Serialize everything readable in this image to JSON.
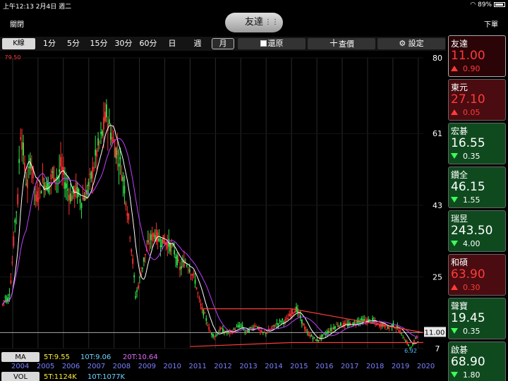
{
  "status": {
    "left": "上午12:13  2月4日 週二",
    "right": "89%"
  },
  "header": {
    "close_label": "關閉",
    "stock_name": "友達",
    "order_label": "下單"
  },
  "toolbar": {
    "kline": "K線",
    "periods": [
      "1分",
      "5分",
      "15分",
      "30分",
      "60分",
      "日",
      "週",
      "月"
    ],
    "restore_label": "還原",
    "lookup_label": "查價",
    "settings_label": "設定"
  },
  "chart_data": {
    "type": "candlestick",
    "symbol": "友達",
    "period": "月",
    "y_ticks": [
      80,
      61,
      43,
      25,
      7
    ],
    "ylim": [
      7,
      80
    ],
    "x_tick_labels": [
      "2004",
      "2005",
      "2006",
      "2007",
      "2008",
      "2009",
      "2010",
      "2011",
      "2012",
      "2013",
      "2014",
      "2015",
      "2016",
      "2017",
      "2018",
      "2019",
      "2020"
    ],
    "xlim": [
      2003.5,
      2020.2
    ],
    "high_label": "79.50",
    "low_label": "6.92",
    "current_price_label": "11.00",
    "current_price": 11.0,
    "price_path": [
      [
        2003.6,
        18
      ],
      [
        2003.7,
        20
      ],
      [
        2003.8,
        19
      ],
      [
        2003.9,
        22
      ],
      [
        2004.0,
        30
      ],
      [
        2004.1,
        40
      ],
      [
        2004.2,
        44
      ],
      [
        2004.3,
        62
      ],
      [
        2004.4,
        58
      ],
      [
        2004.5,
        50
      ],
      [
        2004.6,
        48
      ],
      [
        2004.7,
        55
      ],
      [
        2004.8,
        51
      ],
      [
        2004.9,
        44
      ],
      [
        2005.0,
        46
      ],
      [
        2005.2,
        49
      ],
      [
        2005.4,
        48
      ],
      [
        2005.6,
        51
      ],
      [
        2005.8,
        50
      ],
      [
        2005.9,
        53
      ],
      [
        2006.1,
        48
      ],
      [
        2006.3,
        45
      ],
      [
        2006.5,
        47
      ],
      [
        2006.7,
        44
      ],
      [
        2006.9,
        46
      ],
      [
        2007.1,
        50
      ],
      [
        2007.3,
        56
      ],
      [
        2007.5,
        60
      ],
      [
        2007.7,
        66
      ],
      [
        2007.8,
        63
      ],
      [
        2008.0,
        58
      ],
      [
        2008.2,
        55
      ],
      [
        2008.4,
        48
      ],
      [
        2008.6,
        38
      ],
      [
        2008.75,
        28
      ],
      [
        2008.85,
        20
      ],
      [
        2009.0,
        24
      ],
      [
        2009.2,
        30
      ],
      [
        2009.4,
        34
      ],
      [
        2009.6,
        36
      ],
      [
        2009.8,
        34
      ],
      [
        2010.0,
        34
      ],
      [
        2010.2,
        33
      ],
      [
        2010.4,
        31
      ],
      [
        2010.6,
        27
      ],
      [
        2010.8,
        29
      ],
      [
        2011.0,
        27
      ],
      [
        2011.2,
        24
      ],
      [
        2011.4,
        18
      ],
      [
        2011.6,
        15
      ],
      [
        2011.8,
        11
      ],
      [
        2012.0,
        10
      ],
      [
        2012.2,
        12
      ],
      [
        2012.4,
        11
      ],
      [
        2012.6,
        11
      ],
      [
        2012.8,
        12
      ],
      [
        2013.0,
        13
      ],
      [
        2013.2,
        11
      ],
      [
        2013.4,
        12
      ],
      [
        2013.6,
        13
      ],
      [
        2013.8,
        11
      ],
      [
        2014.0,
        11
      ],
      [
        2014.2,
        12
      ],
      [
        2014.4,
        13
      ],
      [
        2014.6,
        14
      ],
      [
        2014.8,
        14
      ],
      [
        2015.0,
        16
      ],
      [
        2015.2,
        17
      ],
      [
        2015.4,
        14
      ],
      [
        2015.6,
        11
      ],
      [
        2015.8,
        10
      ],
      [
        2016.0,
        9
      ],
      [
        2016.2,
        10
      ],
      [
        2016.4,
        11
      ],
      [
        2016.6,
        12
      ],
      [
        2016.8,
        13
      ],
      [
        2017.0,
        13
      ],
      [
        2017.2,
        13
      ],
      [
        2017.4,
        13
      ],
      [
        2017.6,
        14
      ],
      [
        2017.8,
        14
      ],
      [
        2018.0,
        14
      ],
      [
        2018.2,
        14
      ],
      [
        2018.4,
        13
      ],
      [
        2018.6,
        13
      ],
      [
        2018.8,
        12
      ],
      [
        2019.0,
        13
      ],
      [
        2019.2,
        12
      ],
      [
        2019.4,
        10
      ],
      [
        2019.6,
        8
      ],
      [
        2019.7,
        7
      ],
      [
        2019.8,
        8
      ],
      [
        2019.9,
        10
      ],
      [
        2020.0,
        11
      ]
    ],
    "upper_trendline": [
      [
        2011.5,
        17
      ],
      [
        2014.0,
        17
      ],
      [
        2015.0,
        17
      ],
      [
        2020.2,
        11
      ]
    ],
    "lower_trendline": [
      [
        2011.0,
        7.5
      ],
      [
        2015.0,
        8.5
      ],
      [
        2020.2,
        8.5
      ]
    ],
    "colors": {
      "up": "#ff3030",
      "down": "#2ee84a",
      "ma": "#ffffff",
      "ma2": "#c040ff",
      "trend": "#ff3a3a",
      "grid": "#2a2a2a",
      "label": "#ff3b3b"
    }
  },
  "ma": {
    "tag": "MA",
    "ma5": "5T:9.55",
    "ma10": "10T:9.06",
    "ma20": "20T:10.64"
  },
  "vol": {
    "tag": "VOL",
    "v5": "5T:1124K",
    "v10": "10T:1077K"
  },
  "watchlist": [
    {
      "name": "友達",
      "price": "11.00",
      "change": "0.90",
      "dir": "up",
      "selected": true
    },
    {
      "name": "東元",
      "price": "27.10",
      "change": "0.05",
      "dir": "up"
    },
    {
      "name": "宏碁",
      "price": "16.55",
      "change": "0.35",
      "dir": "down"
    },
    {
      "name": "鑽全",
      "price": "46.15",
      "change": "1.55",
      "dir": "down"
    },
    {
      "name": "瑞昱",
      "price": "243.50",
      "change": "4.00",
      "dir": "down"
    },
    {
      "name": "和碩",
      "price": "63.90",
      "change": "0.30",
      "dir": "up"
    },
    {
      "name": "聲寶",
      "price": "19.45",
      "change": "0.35",
      "dir": "down"
    },
    {
      "name": "啟碁",
      "price": "68.90",
      "change": "1.80",
      "dir": "down"
    }
  ]
}
